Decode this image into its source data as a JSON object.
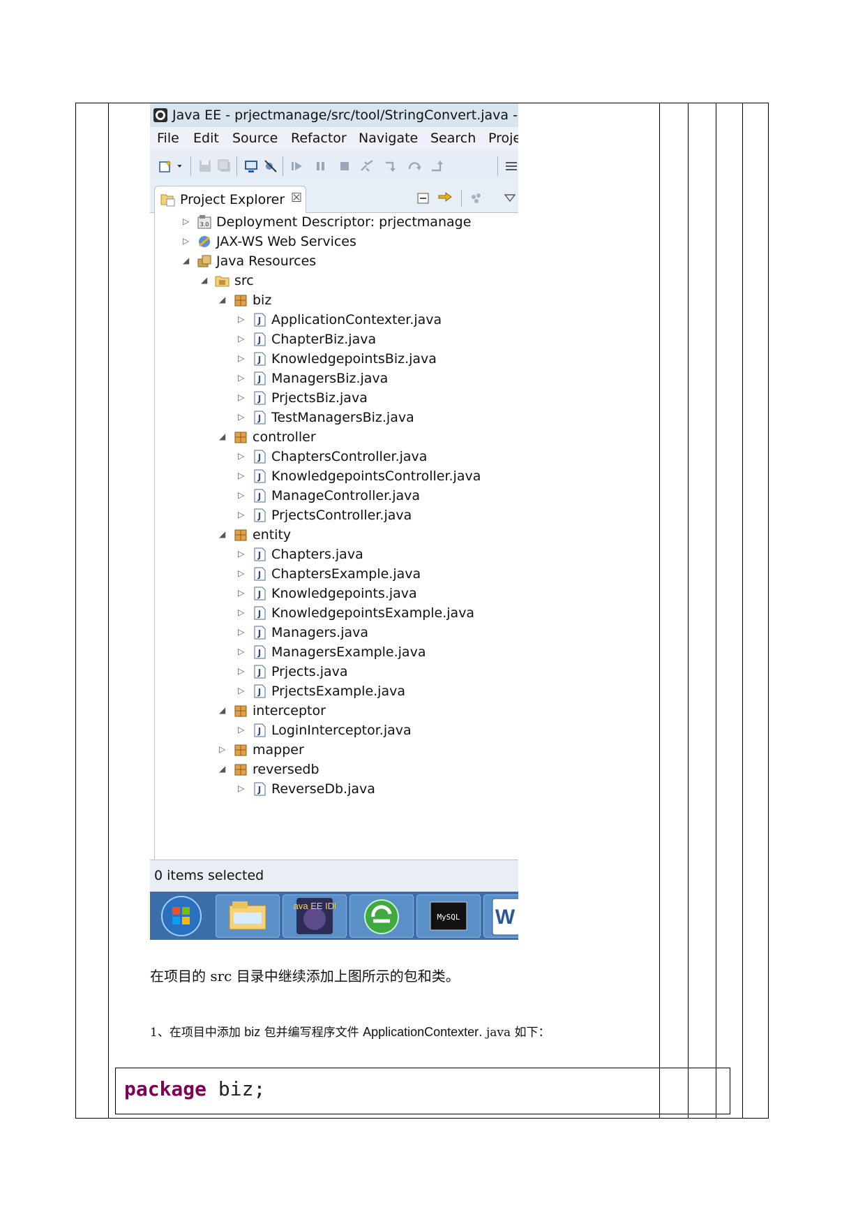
{
  "window": {
    "title": "Java EE - prjectmanage/src/tool/StringConvert.java - Ec",
    "menu": [
      "File",
      "Edit",
      "Source",
      "Refactor",
      "Navigate",
      "Search",
      "Proje"
    ]
  },
  "toolbar_icons": [
    "new-wizard-icon",
    "dropdown-arrow-icon",
    "save-icon",
    "save-all-icon",
    "open-console-icon",
    "skip-breakpoints-icon",
    "resume-icon",
    "suspend-icon",
    "terminate-icon",
    "disconnect-icon",
    "step-into-icon",
    "step-over-icon",
    "step-return-icon",
    "menu-icon"
  ],
  "panel": {
    "tab_label": "Project Explorer",
    "close_glyph": "☒",
    "header_icons": [
      "collapse-all-icon",
      "link-editor-icon",
      "filter-icon",
      "view-menu-icon"
    ]
  },
  "tree": [
    {
      "label": "Deployment Descriptor: prjectmanage",
      "level": 0,
      "expanded": false,
      "icon": "deployment-descriptor-icon"
    },
    {
      "label": "JAX-WS Web Services",
      "level": 0,
      "expanded": false,
      "icon": "web-services-icon"
    },
    {
      "label": "Java Resources",
      "level": 0,
      "expanded": true,
      "icon": "java-resources-icon"
    },
    {
      "label": "src",
      "level": 1,
      "expanded": true,
      "icon": "source-folder-icon"
    },
    {
      "label": "biz",
      "level": 2,
      "expanded": true,
      "icon": "package-icon"
    },
    {
      "label": "ApplicationContexter.java",
      "level": 3,
      "expanded": false,
      "icon": "java-file-icon"
    },
    {
      "label": "ChapterBiz.java",
      "level": 3,
      "expanded": false,
      "icon": "java-file-icon"
    },
    {
      "label": "KnowledgepointsBiz.java",
      "level": 3,
      "expanded": false,
      "icon": "java-file-icon"
    },
    {
      "label": "ManagersBiz.java",
      "level": 3,
      "expanded": false,
      "icon": "java-file-icon"
    },
    {
      "label": "PrjectsBiz.java",
      "level": 3,
      "expanded": false,
      "icon": "java-file-icon"
    },
    {
      "label": "TestManagersBiz.java",
      "level": 3,
      "expanded": false,
      "icon": "java-file-icon"
    },
    {
      "label": "controller",
      "level": 2,
      "expanded": true,
      "icon": "package-icon"
    },
    {
      "label": "ChaptersController.java",
      "level": 3,
      "expanded": false,
      "icon": "java-file-icon"
    },
    {
      "label": "KnowledgepointsController.java",
      "level": 3,
      "expanded": false,
      "icon": "java-file-icon"
    },
    {
      "label": "ManageController.java",
      "level": 3,
      "expanded": false,
      "icon": "java-file-icon"
    },
    {
      "label": "PrjectsController.java",
      "level": 3,
      "expanded": false,
      "icon": "java-file-icon"
    },
    {
      "label": "entity",
      "level": 2,
      "expanded": true,
      "icon": "package-icon"
    },
    {
      "label": "Chapters.java",
      "level": 3,
      "expanded": false,
      "icon": "java-file-icon"
    },
    {
      "label": "ChaptersExample.java",
      "level": 3,
      "expanded": false,
      "icon": "java-file-icon"
    },
    {
      "label": "Knowledgepoints.java",
      "level": 3,
      "expanded": false,
      "icon": "java-file-icon"
    },
    {
      "label": "KnowledgepointsExample.java",
      "level": 3,
      "expanded": false,
      "icon": "java-file-icon"
    },
    {
      "label": "Managers.java",
      "level": 3,
      "expanded": false,
      "icon": "java-file-icon"
    },
    {
      "label": "ManagersExample.java",
      "level": 3,
      "expanded": false,
      "icon": "java-file-icon"
    },
    {
      "label": "Prjects.java",
      "level": 3,
      "expanded": false,
      "icon": "java-file-icon"
    },
    {
      "label": "PrjectsExample.java",
      "level": 3,
      "expanded": false,
      "icon": "java-file-icon"
    },
    {
      "label": "interceptor",
      "level": 2,
      "expanded": true,
      "icon": "package-icon"
    },
    {
      "label": "LoginInterceptor.java",
      "level": 3,
      "expanded": false,
      "icon": "java-file-icon"
    },
    {
      "label": "mapper",
      "level": 2,
      "expanded": false,
      "icon": "package-icon"
    },
    {
      "label": "reversedb",
      "level": 2,
      "expanded": true,
      "icon": "package-icon"
    },
    {
      "label": "ReverseDb.java",
      "level": 3,
      "expanded": false,
      "icon": "java-file-icon"
    }
  ],
  "status": "0 items selected",
  "taskbar": [
    {
      "name": "start-orb-icon",
      "label": ""
    },
    {
      "name": "file-explorer-icon",
      "label": ""
    },
    {
      "name": "java-ee-ide-icon",
      "label": "Java EE IDE"
    },
    {
      "name": "refresh-app-icon",
      "label": ""
    },
    {
      "name": "mysql-console-icon",
      "label": "MySQL"
    },
    {
      "name": "word-icon",
      "label": "W"
    }
  ],
  "doc": {
    "para1": "在项目的 src 目录中继续添加上图所示的包和类。",
    "para2_prefix": "1、在项目中添加 ",
    "para2_biz": "biz",
    "para2_mid": " 包并编写程序文件 ",
    "para2_file": "ApplicationContexter",
    "para2_suffix": ". java 如下：",
    "code_keyword": "package",
    "code_rest": " biz;"
  },
  "colors": {
    "keyword": "#7f0055",
    "titlebar": "#d9e4f1",
    "taskbar": "#3b6ea8"
  }
}
